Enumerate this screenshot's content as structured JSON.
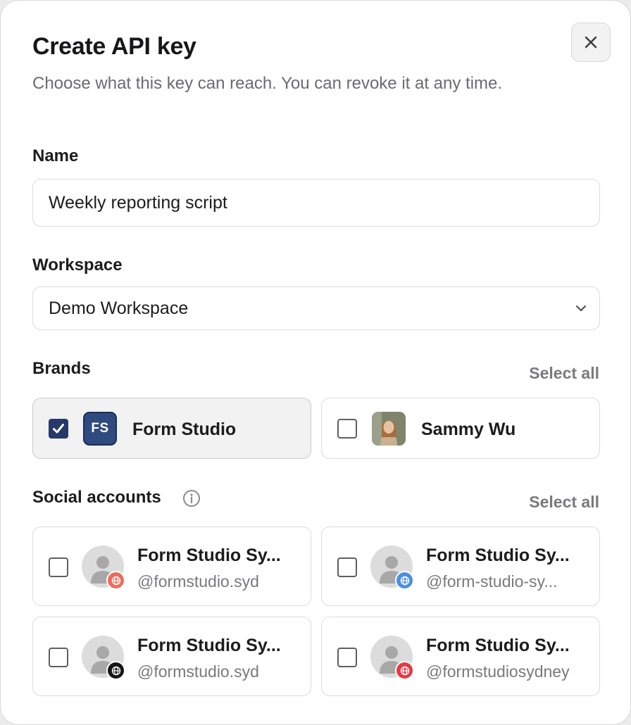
{
  "dialog": {
    "title": "Create API key",
    "subtitle": "Choose what this key can reach. You can revoke it at any time.",
    "close_icon": "close-icon"
  },
  "name_field": {
    "label": "Name",
    "value": "Weekly reporting script"
  },
  "workspace_field": {
    "label": "Workspace",
    "value": "Demo Workspace",
    "icon": "chevron-down-icon"
  },
  "brands": {
    "label": "Brands",
    "select_all": "Select all",
    "items": [
      {
        "name": "Form Studio",
        "initials": "FS",
        "checked": true,
        "avatar_color": "#2f4a7e"
      },
      {
        "name": "Sammy Wu",
        "checked": false,
        "avatar": "photo"
      }
    ]
  },
  "social_accounts": {
    "label": "Social accounts",
    "info_icon": "info-icon",
    "select_all": "Select all",
    "items": [
      {
        "name": "Form Studio Sy...",
        "handle": "@formstudio.syd",
        "badge_color": "#ee6a5a",
        "checked": false
      },
      {
        "name": "Form Studio Sy...",
        "handle": "@form-studio-sy...",
        "badge_color": "#4c8fe0",
        "checked": false
      },
      {
        "name": "Form Studio Sy...",
        "handle": "@formstudio.syd",
        "badge_color": "#161616",
        "checked": false
      },
      {
        "name": "Form Studio Sy...",
        "handle": "@formstudiosydney",
        "badge_color": "#e63946",
        "checked": false
      }
    ]
  },
  "colors": {
    "accent": "#26396a",
    "muted_text": "#7a7a7e"
  }
}
